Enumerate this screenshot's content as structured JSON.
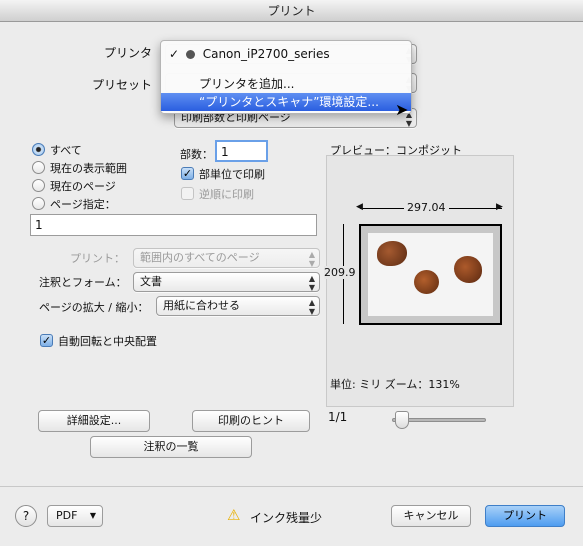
{
  "window": {
    "title": "プリント"
  },
  "printer": {
    "label": "プリンタ",
    "menu": {
      "selected": "Canon_iP2700_series",
      "items": [
        "プリンタを追加...",
        "“プリンタとスキャナ”環境設定..."
      ]
    }
  },
  "preset": {
    "label": "プリセット"
  },
  "section_popup": {
    "value": "印刷部数と印刷ページ"
  },
  "pages": {
    "all": "すべて",
    "current_view": "現在の表示範囲",
    "current_page": "現在のページ",
    "range": "ページ指定：",
    "range_value": "1"
  },
  "copies": {
    "label": "部数：",
    "value": "1",
    "collate": "部単位で印刷",
    "reverse": "逆順に印刷"
  },
  "print_range": {
    "label": "プリント：",
    "value": "範囲内のすべてのページ"
  },
  "annotations": {
    "label": "注釈とフォーム：",
    "value": "文書"
  },
  "scale": {
    "label": "ページの拡大 / 縮小：",
    "value": "用紙に合わせる"
  },
  "auto_rotate": {
    "label": "自動回転と中央配置"
  },
  "preview": {
    "title": "プレビュー：コンポジット",
    "width": "297.04",
    "height": "209.9",
    "units_zoom": "単位: ミリ ズーム：131%",
    "page_counter": "1/1"
  },
  "buttons": {
    "advanced": "詳細設定...",
    "hints": "印刷のヒント",
    "annotations_list": "注釈の一覧",
    "help": "?",
    "pdf": "PDF",
    "cancel": "キャンセル",
    "print": "プリント"
  },
  "status": {
    "ink": "インク残量少"
  }
}
